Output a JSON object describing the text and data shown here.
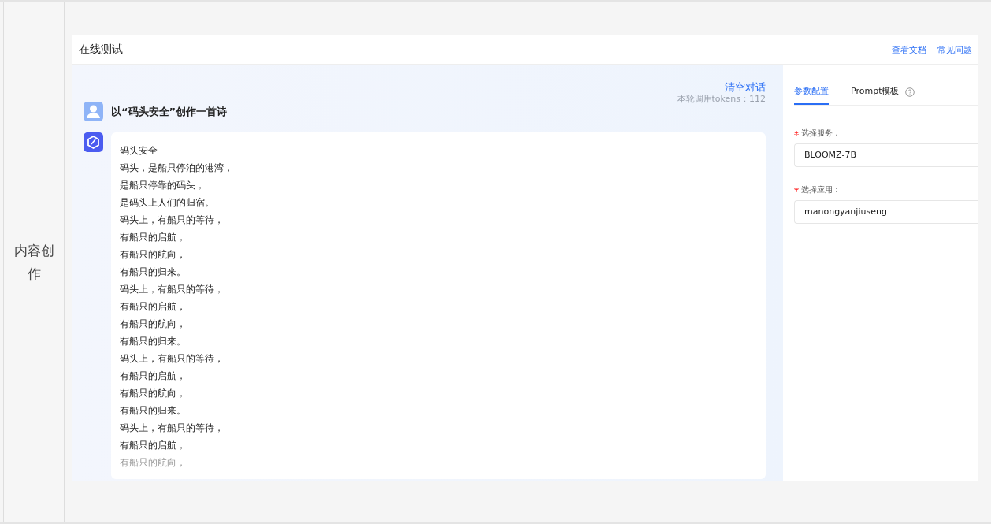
{
  "row_label": "内容创作",
  "header": {
    "title": "在线测试",
    "links": [
      "查看文档",
      "常见问题"
    ]
  },
  "chat": {
    "clear_button": "清空对话",
    "tokens": "本轮调用tokens：112",
    "question": "以“码头安全”创作一首诗",
    "answer_lines": [
      "码头安全",
      "码头，是船只停泊的港湾，",
      "是船只停靠的码头，",
      "是码头上人们的归宿。",
      "码头上，有船只的等待，",
      "有船只的启航，",
      "有船只的航向，",
      "有船只的归来。",
      "码头上，有船只的等待，",
      "有船只的启航，",
      "有船只的航向，",
      "有船只的归来。",
      "码头上，有船只的等待，",
      "有船只的启航，",
      "有船只的航向，",
      "有船只的归来。",
      "码头上，有船只的等待，",
      "有船只的启航，",
      "有船只的航向，"
    ]
  },
  "panel": {
    "tabs": [
      {
        "label": "参数配置",
        "selected": true
      },
      {
        "label": "Prompt模板",
        "selected": false
      }
    ],
    "fields": [
      {
        "label": "选择服务：",
        "required": true,
        "value": "BLOOMZ-7B"
      },
      {
        "label": "选择应用：",
        "required": true,
        "value": "manongyanjiuseng"
      }
    ]
  }
}
